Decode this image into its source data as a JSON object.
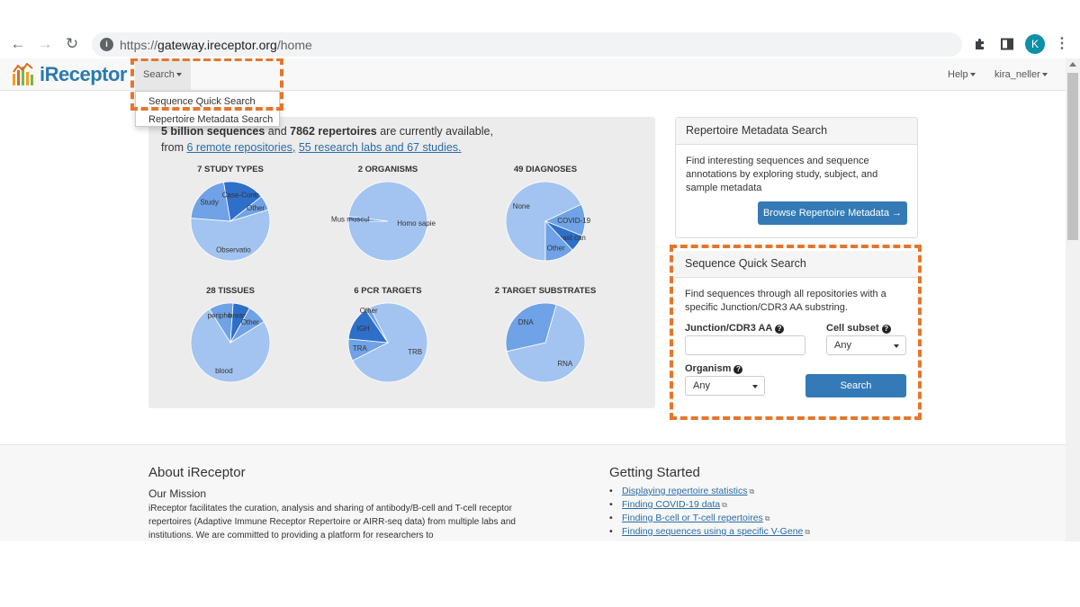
{
  "browser": {
    "url_scheme": "https://",
    "url_host": "gateway.ireceptor.org",
    "url_path": "/home",
    "profile_initial": "K",
    "icons": [
      "back-arrow-icon",
      "forward-arrow-icon",
      "reload-icon",
      "site-info-icon",
      "extensions-puzzle-icon",
      "side-panel-icon",
      "profile-avatar",
      "more-vert-icon"
    ]
  },
  "navbar": {
    "logo_text": "iReceptor",
    "search_label": "Search",
    "help_label": "Help",
    "user_label": "kira_neller",
    "search_dropdown": [
      "Sequence Quick Search",
      "Repertoire Metadata Search"
    ]
  },
  "stats": {
    "line1_hidden": "5 billion sequences",
    "line1_mid": " and ",
    "line1_repertoires": "7862 repertoires",
    "line1_end": " are currently available,",
    "line2_prefix": "from ",
    "line2_link1": "6 remote repositories,",
    "line2_link2": "55 research labs and 67 studies."
  },
  "charts": [
    {
      "title": "7 STUDY TYPES",
      "labels": [
        "Study",
        "Case-Contr",
        "Other",
        "Observatio"
      ]
    },
    {
      "title": "2 ORGANISMS",
      "labels": [
        "Homo sapie",
        "Mus muscul"
      ]
    },
    {
      "title": "49 DIAGNOSES",
      "labels": [
        "COVID-19",
        "breast can",
        "Other",
        "None"
      ]
    },
    {
      "title": "28 TISSUES",
      "labels": [
        "peripheral",
        "breast",
        "Other",
        "blood"
      ]
    },
    {
      "title": "6 PCR TARGETS",
      "labels": [
        "TRA",
        "IGH",
        "Other",
        "TRB"
      ]
    },
    {
      "title": "2 TARGET SUBSTRATES",
      "labels": [
        "DNA",
        "RNA"
      ]
    }
  ],
  "chart_data": [
    {
      "type": "pie",
      "title": "7 STUDY TYPES",
      "categories": [
        "Observatio",
        "Study",
        "Case-Contr",
        "Other"
      ],
      "values": [
        56,
        21,
        17,
        6
      ]
    },
    {
      "type": "pie",
      "title": "2 ORGANISMS",
      "categories": [
        "Homo sapie",
        "Mus muscul"
      ],
      "values": [
        98,
        2
      ]
    },
    {
      "type": "pie",
      "title": "49 DIAGNOSES",
      "categories": [
        "None",
        "COVID-19",
        "breast can",
        "Other"
      ],
      "values": [
        68,
        13,
        7,
        12
      ]
    },
    {
      "type": "pie",
      "title": "28 TISSUES",
      "categories": [
        "blood",
        "peripheral",
        "breast",
        "Other"
      ],
      "values": [
        75,
        10,
        7,
        8
      ]
    },
    {
      "type": "pie",
      "title": "6 PCR TARGETS",
      "categories": [
        "TRB",
        "TRA",
        "IGH",
        "Other"
      ],
      "values": [
        75,
        9,
        14,
        2
      ]
    },
    {
      "type": "pie",
      "title": "2 TARGET SUBSTRATES",
      "categories": [
        "RNA",
        "DNA"
      ],
      "values": [
        67,
        33
      ]
    }
  ],
  "metadata_card": {
    "title": "Repertoire Metadata Search",
    "text": "Find interesting sequences and sequence annotations by exploring study, subject, and sample metadata",
    "button": "Browse Repertoire Metadata →"
  },
  "quick_search_card": {
    "title": "Sequence Quick Search",
    "text": "Find sequences through all repositories with a specific Junction/CDR3 AA substring.",
    "junction_label": "Junction/CDR3 AA",
    "junction_value": "",
    "cell_subset_label": "Cell subset",
    "cell_subset_value": "Any",
    "organism_label": "Organism",
    "organism_value": "Any",
    "search_button": "Search"
  },
  "footer": {
    "about_title": "About iReceptor",
    "mission_title": "Our Mission",
    "mission_text": "iReceptor facilitates the curation, analysis and sharing of antibody/B-cell and T-cell receptor repertoires (Adaptive Immune Receptor Repertoire or AIRR-seq data) from multiple labs and institutions. We are committed to providing a platform for researchers to",
    "gs_title": "Getting Started",
    "gs_links": [
      "Displaying repertoire statistics",
      "Finding COVID-19 data",
      "Finding B-cell or T-cell repertoires",
      "Finding sequences using a specific V-Gene"
    ]
  },
  "colors": {
    "accent": "#337ab7",
    "highlight": "#e5762b",
    "pie_dark": "#2e6fc9",
    "pie_mid": "#6fa2e6",
    "pie_light": "#a3c4f1"
  }
}
